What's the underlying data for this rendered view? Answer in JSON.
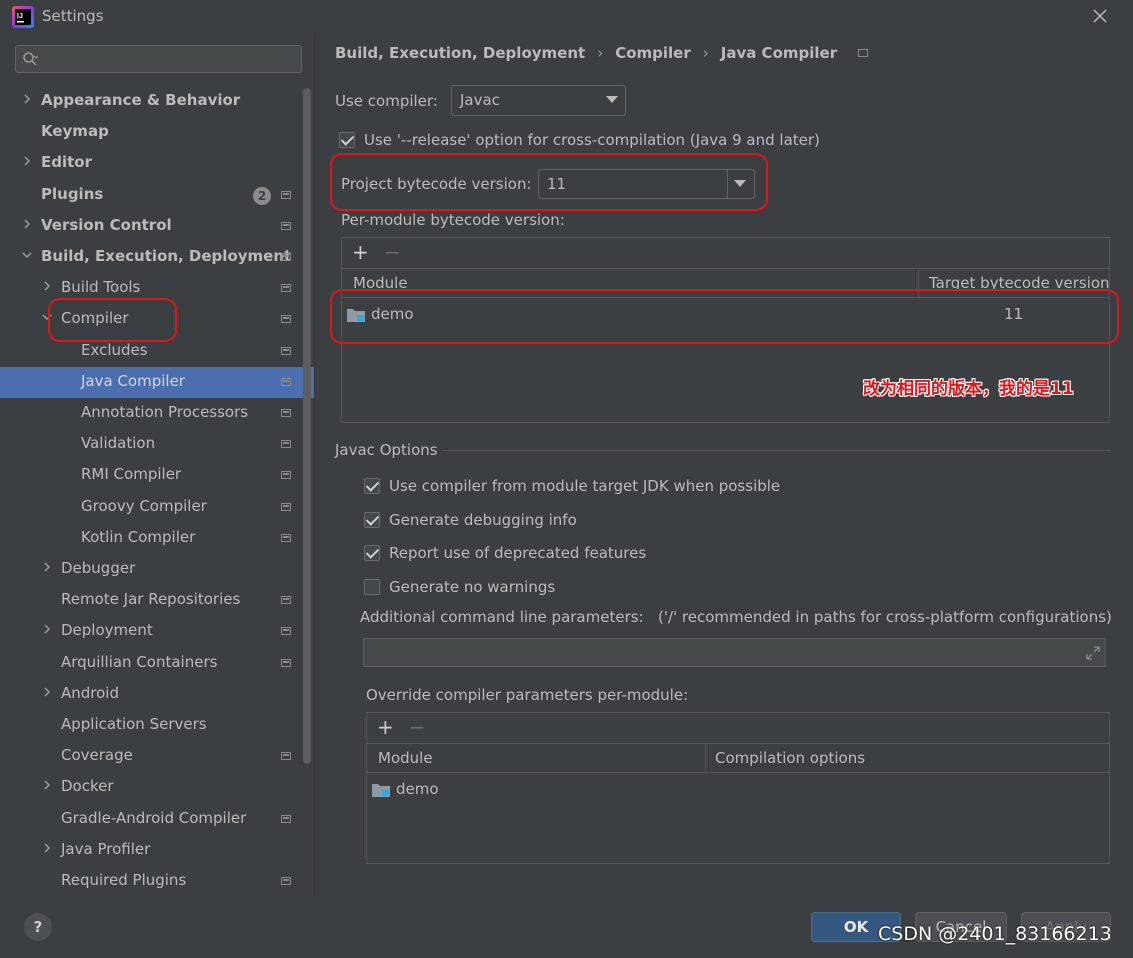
{
  "window": {
    "title": "Settings"
  },
  "sidebar": {
    "search_placeholder": "",
    "items": [
      {
        "label": "Appearance & Behavior",
        "chevron": ">"
      },
      {
        "label": "Keymap"
      },
      {
        "label": "Editor",
        "chevron": ">"
      },
      {
        "label": "Plugins",
        "badge": "2"
      },
      {
        "label": "Version Control",
        "chevron": ">"
      },
      {
        "label": "Build, Execution, Deployment",
        "chevron": "v"
      },
      {
        "label": "Build Tools",
        "chevron": ">"
      },
      {
        "label": "Compiler",
        "chevron": "v"
      },
      {
        "label": "Excludes"
      },
      {
        "label": "Java Compiler"
      },
      {
        "label": "Annotation Processors"
      },
      {
        "label": "Validation"
      },
      {
        "label": "RMI Compiler"
      },
      {
        "label": "Groovy Compiler"
      },
      {
        "label": "Kotlin Compiler"
      },
      {
        "label": "Debugger",
        "chevron": ">"
      },
      {
        "label": "Remote Jar Repositories"
      },
      {
        "label": "Deployment",
        "chevron": ">"
      },
      {
        "label": "Arquillian Containers"
      },
      {
        "label": "Android",
        "chevron": ">"
      },
      {
        "label": "Application Servers"
      },
      {
        "label": "Coverage"
      },
      {
        "label": "Docker",
        "chevron": ">"
      },
      {
        "label": "Gradle-Android Compiler"
      },
      {
        "label": "Java Profiler",
        "chevron": ">"
      },
      {
        "label": "Required Plugins"
      }
    ]
  },
  "breadcrumb": [
    "Build, Execution, Deployment",
    "Compiler",
    "Java Compiler"
  ],
  "compiler": {
    "use_compiler_label": "Use compiler:",
    "use_compiler_value": "Javac",
    "release_option_label": "Use '--release' option for cross-compilation (Java 9 and later)",
    "bytecode_label": "Project bytecode version:",
    "bytecode_value": "11",
    "per_module_label": "Per-module bytecode version:",
    "table": {
      "col_module": "Module",
      "col_target": "Target bytecode version",
      "rows": [
        {
          "module": "demo",
          "target": "11"
        }
      ]
    }
  },
  "annotation": "改为相同的版本，我的是11",
  "javac": {
    "section_title": "Javac Options",
    "options": [
      {
        "label": "Use compiler from module target JDK when possible",
        "checked": true
      },
      {
        "label": "Generate debugging info",
        "checked": true
      },
      {
        "label": "Report use of deprecated features",
        "checked": true
      },
      {
        "label": "Generate no warnings",
        "checked": false
      }
    ],
    "cmd_label": "Additional command line parameters:",
    "cmd_hint": "('/' recommended in paths for cross-platform configurations)",
    "override_label": "Override compiler parameters per-module:",
    "override_table": {
      "col_module": "Module",
      "col_options": "Compilation options",
      "rows": [
        {
          "module": "demo"
        }
      ]
    }
  },
  "buttons": {
    "help": "?",
    "ok": "OK",
    "cancel": "Cancel",
    "apply": "Apply"
  },
  "watermark": "CSDN @2401_83166213",
  "colors": {
    "selection": "#4b6eaf",
    "annotation_red": "#e0161d",
    "primary_button": "#365880"
  }
}
